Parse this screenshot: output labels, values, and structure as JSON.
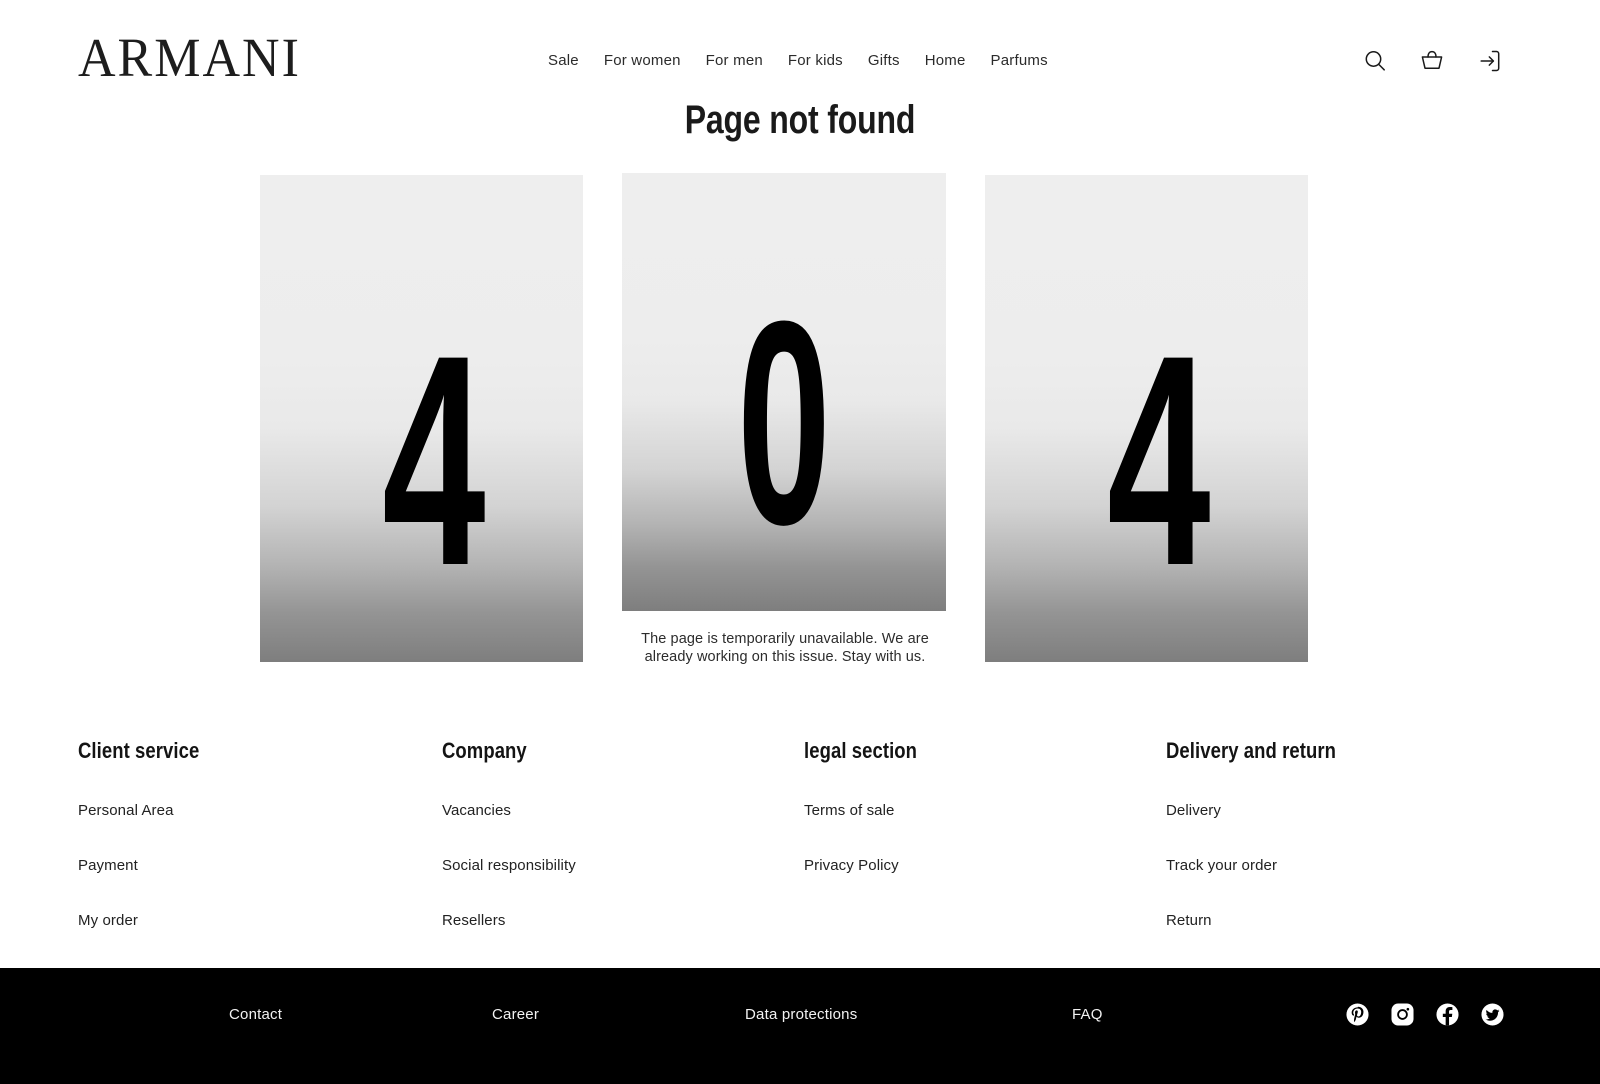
{
  "header": {
    "logo": "ARMANI",
    "nav": [
      {
        "label": "Sale"
      },
      {
        "label": "For women"
      },
      {
        "label": "For men"
      },
      {
        "label": "For kids"
      },
      {
        "label": "Gifts"
      },
      {
        "label": "Home"
      },
      {
        "label": "Parfums"
      }
    ],
    "icons": [
      {
        "name": "search-icon"
      },
      {
        "name": "basket-icon"
      },
      {
        "name": "login-icon"
      }
    ]
  },
  "main": {
    "title": "Page not found",
    "digits": [
      "4",
      "0",
      "4"
    ],
    "caption": "The page is temporarily unavailable. We are already working on this issue. Stay with us."
  },
  "footer": {
    "columns": [
      {
        "heading": "Client service",
        "links": [
          "Personal Area",
          "Payment",
          "My order"
        ]
      },
      {
        "heading": "Company",
        "links": [
          "Vacancies",
          "Social responsibility",
          "Resellers"
        ]
      },
      {
        "heading": "legal section",
        "links": [
          "Terms of sale",
          "Privacy Policy"
        ]
      },
      {
        "heading": "Delivery and return",
        "links": [
          "Delivery",
          "Track your order",
          "Return"
        ]
      }
    ]
  },
  "bottom_bar": {
    "background": "#000000",
    "links": [
      "Contact",
      "Career",
      "Data protections",
      "FAQ"
    ],
    "socials": [
      {
        "name": "pinterest-icon"
      },
      {
        "name": "instagram-icon"
      },
      {
        "name": "facebook-icon"
      },
      {
        "name": "twitter-icon"
      }
    ]
  },
  "colors": {
    "page_background": "#ffffff",
    "text": "#1a1a1a",
    "panel_top": "#eeeeee",
    "panel_bottom": "#7e7e7e",
    "bar": "#000000"
  }
}
